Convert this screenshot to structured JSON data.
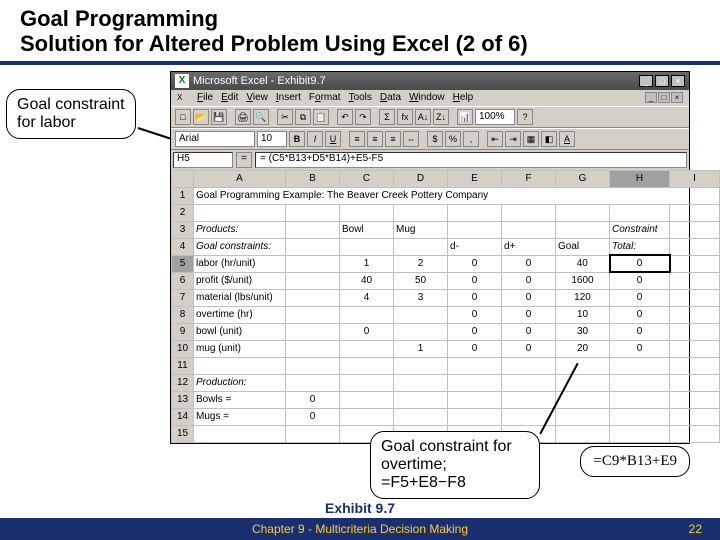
{
  "slide": {
    "title_line1": "Goal Programming",
    "title_line2": "Solution for Altered Problem Using Excel (2 of 6)"
  },
  "callouts": {
    "labor": "Goal constraint for labor",
    "overtime_l1": "Goal constraint for overtime;",
    "overtime_l2": "=F5+E8−F8",
    "formula": "=C9*B13+E9"
  },
  "excel": {
    "title": "Microsoft Excel - Exhibit9.7",
    "menus": [
      "File",
      "Edit",
      "View",
      "Insert",
      "Format",
      "Tools",
      "Data",
      "Window",
      "Help"
    ],
    "font_name": "Arial",
    "font_size": "10",
    "namebox": "H5",
    "formula": "= (C5*B13+D5*B14)+E5-F5",
    "cols": [
      "A",
      "B",
      "C",
      "D",
      "E",
      "F",
      "G",
      "H",
      "I"
    ],
    "rows": [
      {
        "n": "1",
        "A": "Goal Programming Example: The Beaver Creek Pottery Company"
      },
      {
        "n": "2"
      },
      {
        "n": "3",
        "A": "Products:",
        "C": "Bowl",
        "D": "Mug",
        "H": "Constraint"
      },
      {
        "n": "4",
        "A": "Goal constraints:",
        "E": "d-",
        "F": "d+",
        "G": "Goal",
        "H": "Total:"
      },
      {
        "n": "5",
        "A": "  labor (hr/unit)",
        "C": "1",
        "D": "2",
        "E": "0",
        "F": "0",
        "G": "40",
        "H": "0"
      },
      {
        "n": "6",
        "A": "  profit ($/unit)",
        "C": "40",
        "D": "50",
        "E": "0",
        "F": "0",
        "G": "1600",
        "H": "0"
      },
      {
        "n": "7",
        "A": "  material (lbs/unit)",
        "C": "4",
        "D": "3",
        "E": "0",
        "F": "0",
        "G": "120",
        "H": "0"
      },
      {
        "n": "8",
        "A": "  overtime (hr)",
        "E": "0",
        "F": "0",
        "G": "10",
        "H": "0"
      },
      {
        "n": "9",
        "A": "  bowl (unit)",
        "C": "0",
        "E": "0",
        "F": "0",
        "G": "30",
        "H": "0"
      },
      {
        "n": "10",
        "A": "  mug (unit)",
        "D": "1",
        "E": "0",
        "F": "0",
        "G": "20",
        "H": "0"
      },
      {
        "n": "11"
      },
      {
        "n": "12",
        "A": "Production:"
      },
      {
        "n": "13",
        "A": "  Bowls =",
        "B": "0"
      },
      {
        "n": "14",
        "A": "  Mugs =",
        "B": "0"
      },
      {
        "n": "15"
      }
    ]
  },
  "footer": {
    "exhibit": "Exhibit 9.7",
    "chapter": "Chapter 9 - Multicriteria Decision Making",
    "page": "22"
  },
  "chart_data": {
    "type": "table",
    "title": "Goal Programming Example: The Beaver Creek Pottery Company",
    "columns": [
      "Goal constraint",
      "Bowl",
      "Mug",
      "d-",
      "d+",
      "Goal",
      "Constraint Total"
    ],
    "rows": [
      [
        "labor (hr/unit)",
        1,
        2,
        0,
        0,
        40,
        0
      ],
      [
        "profit ($/unit)",
        40,
        50,
        0,
        0,
        1600,
        0
      ],
      [
        "material (lbs/unit)",
        4,
        3,
        0,
        0,
        120,
        0
      ],
      [
        "overtime (hr)",
        null,
        null,
        0,
        0,
        10,
        0
      ],
      [
        "bowl (unit)",
        0,
        null,
        0,
        0,
        30,
        0
      ],
      [
        "mug (unit)",
        null,
        1,
        0,
        0,
        20,
        0
      ]
    ],
    "production": {
      "Bowls": 0,
      "Mugs": 0
    },
    "formulas": {
      "H5": "=(C5*B13+D5*B14)+E5-F5",
      "H8": "=F5+E8-F8",
      "H9": "=C9*B13+E9"
    }
  }
}
